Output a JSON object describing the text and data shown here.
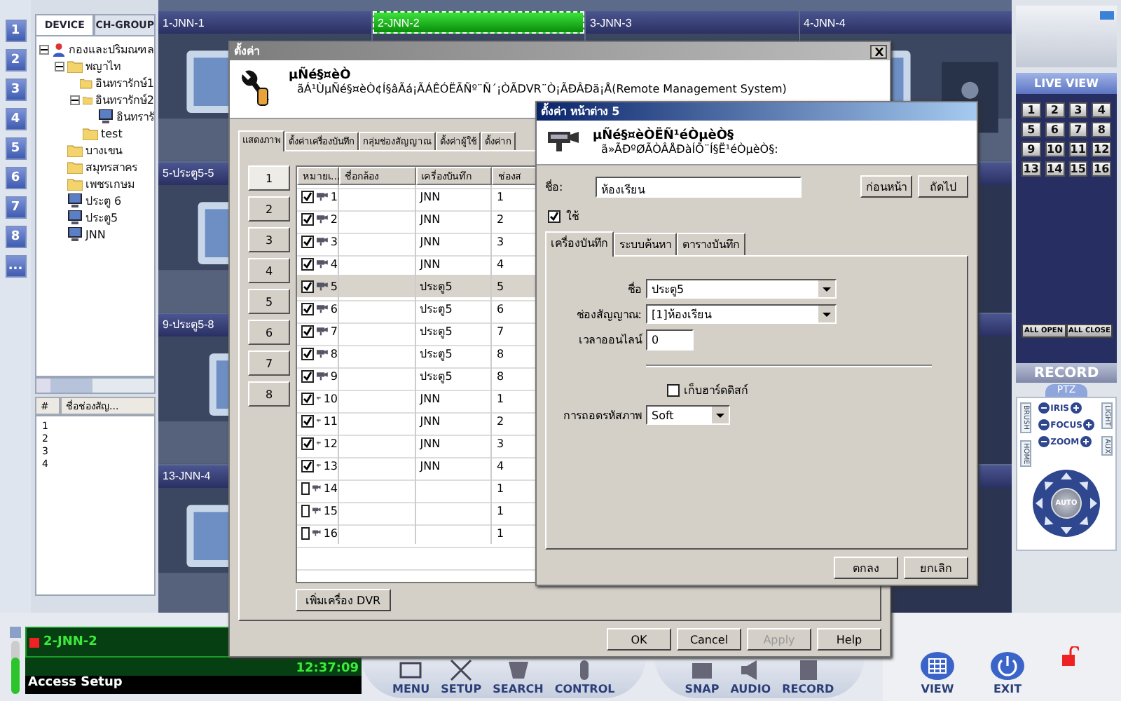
{
  "left_strip": {
    "buttons": [
      "1",
      "2",
      "3",
      "4",
      "5",
      "6",
      "7",
      "8",
      "..."
    ]
  },
  "device_panel": {
    "tabs": [
      {
        "label": "DEVICE",
        "selected": true
      },
      {
        "label": "CH-GROUP",
        "selected": false
      }
    ],
    "tree": [
      {
        "label": "กองและปริมณฑล",
        "kind": "site",
        "expanded": true,
        "children": [
          {
            "label": "พญาไท",
            "kind": "folder",
            "expanded": true,
            "children": [
              {
                "label": "อินทรารักษ์1",
                "kind": "folder"
              },
              {
                "label": "อินทรารักษ์2",
                "kind": "folder",
                "expanded": true,
                "children": [
                  {
                    "label": "อินทรารั",
                    "kind": "device"
                  }
                ]
              },
              {
                "label": "test",
                "kind": "folder"
              }
            ]
          },
          {
            "label": "บางเขน",
            "kind": "folder"
          },
          {
            "label": "สมุทรสาคร",
            "kind": "folder"
          },
          {
            "label": "เพชรเกษม",
            "kind": "folder"
          },
          {
            "label": "ประตู 6",
            "kind": "device"
          },
          {
            "label": "ประตู5",
            "kind": "device"
          },
          {
            "label": "JNN",
            "kind": "device"
          }
        ]
      }
    ],
    "channel_list": {
      "columns": [
        "#",
        "ชื่อช่องสัญ..."
      ],
      "rows": [
        "1",
        "2",
        "3",
        "4"
      ]
    }
  },
  "video_rows": [
    [
      {
        "title": "1-JNN-1",
        "selected": false
      },
      {
        "title": "2-JNN-2",
        "selected": true
      },
      {
        "title": "3-JNN-3",
        "selected": false
      },
      {
        "title": "4-JNN-4",
        "selected": false
      }
    ],
    [
      {
        "title": "5-ประตู5-5",
        "selected": false
      }
    ],
    [
      {
        "title": "9-ประตู5-8",
        "selected": false
      }
    ],
    [
      {
        "title": "13-JNN-4",
        "selected": false
      }
    ]
  ],
  "main_dialog": {
    "title": "ตั้งค่า",
    "heading": "µÑé§¤èÒ",
    "subtitle": "ãÁ¹ÙµÑé§¤èÒ¢Í§âÃá¡ÃÁÊÓËÃÑº¨Ñ´¡ÒÃDVR¨Ò¡ÃÐÂÐä¡Å(Remote Management System)",
    "tabs": [
      {
        "label": "แสดงภาพ",
        "selected": true
      },
      {
        "label": "ตั้งค่าเครื่องบันทึก",
        "selected": false
      },
      {
        "label": "กลุ่มช่องสัญญาณ",
        "selected": false
      },
      {
        "label": "ตั้งค่าผู้ใช้",
        "selected": false
      },
      {
        "label": "ตั้งค่าก",
        "selected": false
      }
    ],
    "page_buttons": [
      {
        "label": "1",
        "selected": true
      },
      {
        "label": "2",
        "selected": false
      },
      {
        "label": "3",
        "selected": false
      },
      {
        "label": "4",
        "selected": false
      },
      {
        "label": "5",
        "selected": false
      },
      {
        "label": "6",
        "selected": false
      },
      {
        "label": "7",
        "selected": false
      },
      {
        "label": "8",
        "selected": false
      }
    ],
    "table": {
      "columns": [
        "หมายเ...",
        "ชื่อกล้อง",
        "เครื่องบันทึก",
        "ช่องส"
      ],
      "rows": [
        {
          "enabled": true,
          "number": "1",
          "recorder": "JNN",
          "channel": "1",
          "selected": false
        },
        {
          "enabled": true,
          "number": "2",
          "recorder": "JNN",
          "channel": "2",
          "selected": false
        },
        {
          "enabled": true,
          "number": "3",
          "recorder": "JNN",
          "channel": "3",
          "selected": false
        },
        {
          "enabled": true,
          "number": "4",
          "recorder": "JNN",
          "channel": "4",
          "selected": false
        },
        {
          "enabled": true,
          "number": "5",
          "recorder": "ประตู5",
          "channel": "5",
          "selected": true
        },
        {
          "enabled": true,
          "number": "6",
          "recorder": "ประตู5",
          "channel": "6",
          "selected": false
        },
        {
          "enabled": true,
          "number": "7",
          "recorder": "ประตู5",
          "channel": "7",
          "selected": false
        },
        {
          "enabled": true,
          "number": "8",
          "recorder": "ประตู5",
          "channel": "8",
          "selected": false
        },
        {
          "enabled": true,
          "number": "9",
          "recorder": "ประตู5",
          "channel": "8",
          "selected": false
        },
        {
          "enabled": true,
          "number": "10",
          "recorder": "JNN",
          "channel": "1",
          "selected": false
        },
        {
          "enabled": true,
          "number": "11",
          "recorder": "JNN",
          "channel": "2",
          "selected": false
        },
        {
          "enabled": true,
          "number": "12",
          "recorder": "JNN",
          "channel": "3",
          "selected": false
        },
        {
          "enabled": true,
          "number": "13",
          "recorder": "JNN",
          "channel": "4",
          "selected": false
        },
        {
          "enabled": false,
          "number": "14",
          "channel": "1",
          "selected": false
        },
        {
          "enabled": false,
          "number": "15",
          "channel": "1",
          "selected": false
        },
        {
          "enabled": false,
          "number": "16",
          "channel": "1",
          "selected": false
        }
      ]
    },
    "add_button": "เพิ่มเครื่อง DVR",
    "buttons": [
      {
        "label": "OK",
        "disabled": false
      },
      {
        "label": "Cancel",
        "disabled": false
      },
      {
        "label": "Apply",
        "disabled": true
      },
      {
        "label": "Help",
        "disabled": false
      }
    ]
  },
  "window_dialog": {
    "title": "ตั้งค่า หน้าต่าง 5",
    "heading": "µÑé§¤èÒËÑ¹éÒµèÒ§",
    "subtitle": "ã»ÃÐºØÃÒÂÅÐàÍÕ¨Í§Ë¹éÒµèÒ§:",
    "name_label": "ชื่อ:",
    "name_value": "ห้องเรียน",
    "nav_buttons": [
      "ก่อนหน้า",
      "ถัดไป"
    ],
    "enable": {
      "label": "ใช้",
      "checked": true
    },
    "tabs": [
      {
        "label": "เครื่องบันทึก",
        "selected": true
      },
      {
        "label": "ระบบค้นหา",
        "selected": false
      },
      {
        "label": "ตารางบันทึก",
        "selected": false
      }
    ],
    "fields": [
      {
        "kind": "select",
        "label": "ชื่อ",
        "value": "ประตู5"
      },
      {
        "kind": "select",
        "label": "ช่องสัญญาณ:",
        "value": "[1]ห้องเรียน"
      },
      {
        "kind": "input",
        "label": "เวลาออนไลน์",
        "value": "0"
      },
      {
        "kind": "divider"
      },
      {
        "kind": "checkbox",
        "label": "เก็บฮาร์ดดิสก์",
        "checked": false
      },
      {
        "kind": "combo",
        "label": "การถอดรหัสภาพ",
        "value": "Soft"
      }
    ],
    "buttons": [
      "ตกลง",
      "ยกเลิก"
    ]
  },
  "right_panel": {
    "live_view": "LIVE VIEW",
    "channels": [
      "1",
      "2",
      "3",
      "4",
      "5",
      "6",
      "7",
      "8",
      "9",
      "10",
      "11",
      "12",
      "13",
      "14",
      "15",
      "16"
    ],
    "all_buttons": [
      "ALL OPEN",
      "ALL CLOSE"
    ],
    "record": "RECORD",
    "ptz": {
      "tab": "PTZ",
      "left_labels": [
        "BRUSH",
        "HOME"
      ],
      "right_labels": [
        "LIGHT",
        "AUX"
      ],
      "controls": [
        "IRIS",
        "FOCUS",
        "ZOOM"
      ],
      "auto": "AUTO"
    }
  },
  "status": {
    "camera": "2-JNN-2",
    "time": "12:37:09",
    "message": "Access Setup"
  },
  "toolbar": [
    {
      "label": "MENU",
      "kind": "menu"
    },
    {
      "label": "SETUP",
      "kind": "setup"
    },
    {
      "label": "SEARCH",
      "kind": "search"
    },
    {
      "label": "CONTROL",
      "kind": "control"
    },
    {
      "label": "SNAP",
      "kind": "snap"
    },
    {
      "label": "AUDIO",
      "kind": "audio"
    },
    {
      "label": "RECORD",
      "kind": "record"
    }
  ],
  "view_buttons": [
    {
      "label": "VIEW",
      "kind": "grid"
    },
    {
      "label": "EXIT",
      "kind": "power"
    }
  ]
}
